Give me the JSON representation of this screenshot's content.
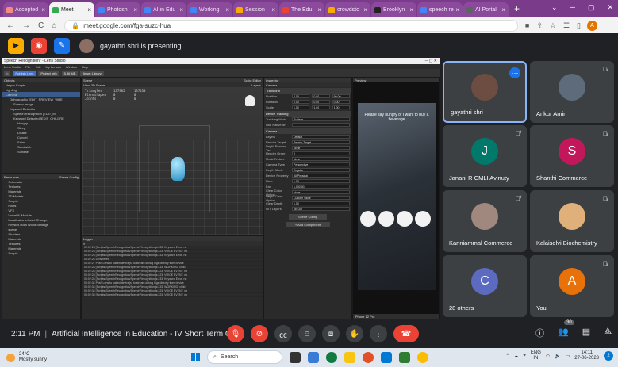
{
  "browser": {
    "tabs": [
      {
        "label": "Accepted",
        "color": "#f28b82",
        "active": false
      },
      {
        "label": "Meet",
        "color": "#34a853",
        "active": true
      },
      {
        "label": "Photosh",
        "color": "#4285f4",
        "active": false
      },
      {
        "label": "AI in Edu",
        "color": "#4285f4",
        "active": false
      },
      {
        "label": "Working",
        "color": "#4285f4",
        "active": false
      },
      {
        "label": "Session",
        "color": "#f9ab00",
        "active": false
      },
      {
        "label": "The Edu",
        "color": "#ea4335",
        "active": false
      },
      {
        "label": "crowdsto",
        "color": "#f9ab00",
        "active": false
      },
      {
        "label": "Brooklyn",
        "color": "#222222",
        "active": false
      },
      {
        "label": "speech re",
        "color": "#4285f4",
        "active": false
      },
      {
        "label": "AI Portal",
        "color": "#5f6368",
        "active": false
      }
    ],
    "new_tab": "+",
    "url": "meet.google.com/fga-suzc-hua",
    "profile_initial": "A"
  },
  "meet_top": {
    "presenting_text": "gayathri shri is presenting"
  },
  "lens_studio": {
    "window_title": "Speech Recognition* - Lens Studio",
    "menu": [
      "Lens Studio",
      "File",
      "Edit",
      "My Lenses",
      "Window",
      "Help"
    ],
    "toolbar": [
      "Publish Lens",
      "Project Info",
      "5.36 MB",
      "Asset Library"
    ],
    "objects_header": "Objects",
    "objects": [
      "Helper Scripts",
      "Lighting",
      "Camera",
      "Orthographic [EDIT_PREVIEW_WHE",
      "Screen Image",
      "Keyword Detection",
      "Speech Recognition [EDIT_M",
      "Keyword Detected [EDIT_CHILDRE",
      "Hungry",
      "Sleep",
      "Dislike",
      "Cancel",
      "Salad",
      "Sandwich",
      "Sundae"
    ],
    "resources_header": "Resources",
    "scene_config": "Scene Config",
    "resources": [
      "Scheduler",
      "Textures",
      "Materials",
      "3D Models",
      "Scripts",
      "Fonts",
      "VFX",
      "VoiceML Module",
      "Localizations Asset Change",
      "Physics Root World Settings",
      "scene",
      "Shaders",
      "Materials",
      "Textures",
      "Materials",
      "Scripts"
    ],
    "scene_header": "Scene",
    "script_editor": "Script Editor",
    "view_tab": "View 3D Scene",
    "stats": [
      [
        "Triangles",
        "137985",
        "137430"
      ],
      [
        "Blendshapes",
        "0",
        "0"
      ],
      [
        "Joints",
        "0",
        "0"
      ]
    ],
    "layers_label": "Layers",
    "logger_header": "Logger",
    "log_lines": [
      "00:02:23 [Scripts/SpeechRecognition/SpeechRecognition.js:233] Keyword Error: no",
      "00:02:23 [Scripts/SpeechRecognition/SpeechRecognition.js:223] VOICE EVENT: no",
      "00:02:26 [Scripts/SpeechRecognition/SpeechRecognition.js:233] Keyword Error: no",
      "00:02:26 Lens reset",
      "00:02:27 Push Lens to paired device(s) to stream debug logs directly from device",
      "00:02:28 [Scripts/SpeechRecognition/SpeechRecognition.js:233] WORKING: child",
      "00:02:28 [Scripts/SpeechRecognition/SpeechRecognition.js:223] VOICE EVENT: no",
      "00:02:28 [Scripts/SpeechRecognition/SpeechRecognition.js:223] VOICE EVENT: no",
      "00:02:28 [Scripts/SpeechRecognition/SpeechRecognition.js:233] Keyword Error: no",
      "00:02:34 Push Lens to paired device(s) to stream debug logs directly from device",
      "00:02:34 [Scripts/SpeechRecognition/SpeechRecognition.js:233] WORKING: child",
      "00:02:34 [Scripts/SpeechRecognition/SpeechRecognition.js:223] VOICE EVENT: no",
      "00:02:35 [Scripts/SpeechRecognition/SpeechRecognition.js:223] VOICE EVENT: no"
    ],
    "inspector_header": "Inspector",
    "inspector_object": "Camera",
    "transform_header": "Transform",
    "transform_rows": [
      [
        "Position",
        "0.00",
        "0.00",
        "90.00"
      ],
      [
        "Rotation",
        "0.00",
        "0.00",
        "0.00"
      ],
      [
        "Scale",
        "1.00",
        "1.00",
        "1.00"
      ]
    ],
    "tracking_header": "Device Tracking",
    "tracking_rows": [
      [
        "Tracking Mode",
        "Surface"
      ],
      [
        "Use Native AR",
        ""
      ]
    ],
    "camera_header": "Camera",
    "camera_rows": [
      [
        "Layers",
        "Default"
      ],
      [
        "Render Target",
        "Render Target"
      ],
      [
        "Depth Render Tar",
        "None"
      ],
      [
        "Render Order",
        "0"
      ],
      [
        "Mask Texture",
        "None"
      ],
      [
        "Camera Type",
        "Perspective"
      ],
      [
        "Depth Mode",
        "Regular"
      ],
      [
        "Device Property",
        "All Physical"
      ],
      [
        "Near",
        "1.00"
      ],
      [
        "Far",
        "1,000.00"
      ],
      [
        "Clear Color Option",
        "None"
      ],
      [
        "Depth Clear Option",
        "Custom Value"
      ],
      [
        "Clear Depth",
        "1.00"
      ],
      [
        "OIT Layers",
        "No OIT"
      ]
    ],
    "scene_config_btn": "Scene Config",
    "add_component": "+ Add Component",
    "preview_header": "Preview",
    "preview_text": "Please say hungry or I want to buy a beverage",
    "preview_footer": "iPhone 12 Pro"
  },
  "participants": [
    {
      "name": "gayathri shri",
      "active": true,
      "muted": false
    },
    {
      "name": "Ankur Amin",
      "muted": true
    },
    {
      "name": "Janani R CMLI Avinuty",
      "initial": "J",
      "color": "#00796b",
      "muted": true
    },
    {
      "name": "Shanthi Commerce",
      "initial": "S",
      "color": "#c2185b",
      "muted": true
    },
    {
      "name": "Kanniammal Commerce",
      "muted": true
    },
    {
      "name": "Kalaiselvi Biochemistry",
      "muted": true
    },
    {
      "name": "28 others",
      "initial": "C",
      "color": "#5c6bc0"
    },
    {
      "name": "You",
      "initial": "A",
      "color": "#e8710a",
      "muted": true
    }
  ],
  "controls": {
    "time": "2:11 PM",
    "meeting_name": "Artificial Intelligence in Education - IV Short Term C...",
    "participants_badge": "30"
  },
  "taskbar": {
    "temperature": "24°C",
    "weather": "Mostly sunny",
    "search": "Search",
    "lang_1": "ENG",
    "lang_2": "IN",
    "time": "14:11",
    "date": "27-06-2023",
    "notifications": "2"
  },
  "colors": {
    "meet_bg": "#202124",
    "tile_bg": "#3c4043",
    "accent": "#8ab4f8",
    "leave": "#ea4335"
  }
}
